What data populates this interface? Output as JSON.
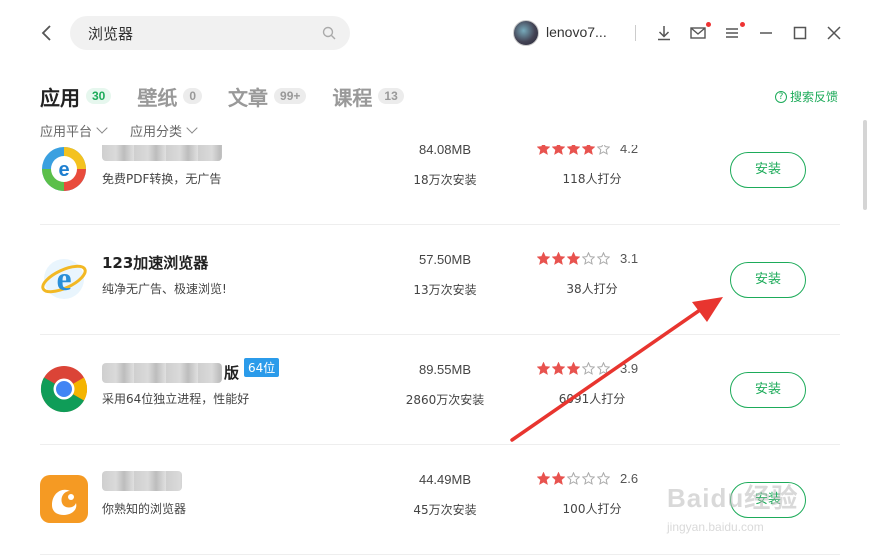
{
  "search": {
    "value": "浏览器"
  },
  "user": {
    "name": "lenovo7..."
  },
  "tabs": [
    {
      "label": "应用",
      "count": "30",
      "active": true
    },
    {
      "label": "壁纸",
      "count": "0"
    },
    {
      "label": "文章",
      "count": "99+"
    },
    {
      "label": "课程",
      "count": "13"
    }
  ],
  "feedback_label": "搜索反馈",
  "filters": [
    {
      "label": "应用平台"
    },
    {
      "label": "应用分类"
    }
  ],
  "install_label": "安装",
  "apps": [
    {
      "name": "",
      "name_hidden": true,
      "description": "免费PDF转换，无广告",
      "size": "84.08MB",
      "installs": "18万次安装",
      "rating": 4.2,
      "score_text": "4.2",
      "raters": "118人打分",
      "icon": "ie-colorful-icon"
    },
    {
      "name": "123加速浏览器",
      "description": "纯净无广告、极速浏览!",
      "size": "57.50MB",
      "installs": "13万次安装",
      "rating": 3.1,
      "score_text": "3.1",
      "raters": "38人打分",
      "icon": "ie-blue-icon"
    },
    {
      "name": "版",
      "name_hidden": true,
      "tag": "64位",
      "description": "采用64位独立进程，性能好",
      "size": "89.55MB",
      "installs": "2860万次安装",
      "rating": 3.9,
      "score_text": "3.9",
      "raters": "6091人打分",
      "icon": "chrome-icon"
    },
    {
      "name": "",
      "name_hidden": true,
      "description": "你熟知的浏览器",
      "size": "44.49MB",
      "installs": "45万次安装",
      "rating": 2.6,
      "score_text": "2.6",
      "raters": "100人打分",
      "icon": "uc-browser-icon"
    }
  ],
  "watermark": {
    "text": "Baidu经验",
    "url": "jingyan.baidu.com"
  },
  "colors": {
    "accent": "#1dab5a",
    "star": "#e8534f",
    "tag": "#2b9bea",
    "arrow": "#e8352f"
  }
}
